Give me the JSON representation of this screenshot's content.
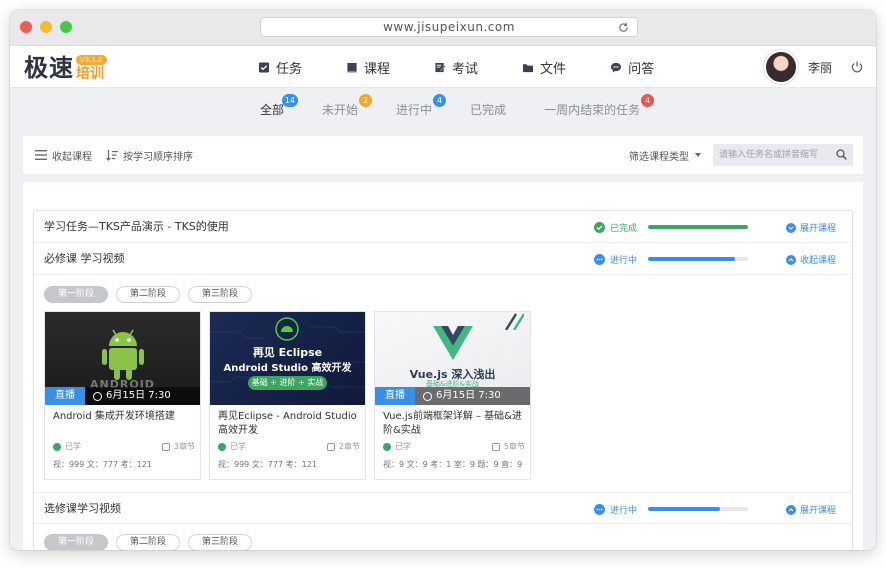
{
  "browser": {
    "url": "www.jisupeixun.com"
  },
  "brand": {
    "name": "极速",
    "version": "V3.1.0",
    "sub": "培训"
  },
  "nav": {
    "items": [
      {
        "label": "任务",
        "icon": "task-checkbox-icon"
      },
      {
        "label": "课程",
        "icon": "course-book-icon"
      },
      {
        "label": "考试",
        "icon": "exam-pencil-icon"
      },
      {
        "label": "文件",
        "icon": "folder-icon"
      },
      {
        "label": "问答",
        "icon": "chat-bubble-icon"
      }
    ]
  },
  "user": {
    "name": "李丽"
  },
  "filters": [
    {
      "label": "全部",
      "count": "14",
      "color": "#3a8ee6"
    },
    {
      "label": "未开始",
      "count": "2",
      "color": "#f5a623"
    },
    {
      "label": "进行中",
      "count": "4",
      "color": "#3a8ee6"
    },
    {
      "label": "已完成",
      "count": "",
      "color": ""
    },
    {
      "label": "一周内结束的任务",
      "count": "4",
      "color": "#ef5350"
    }
  ],
  "toolbar": {
    "collapse": "收起课程",
    "sort": "按学习顺序排序",
    "type_filter": "筛选课程类型",
    "search_placeholder": "请输入任务名或拼音缩写"
  },
  "task": {
    "title": "学习任务—TKS产品演示 - TKS的使用",
    "status": "已完成",
    "progress": 1.0,
    "action": "展开课程"
  },
  "required": {
    "title": "必修课 学习视频",
    "status": "进行中",
    "progress": 0.87,
    "action": "收起课程",
    "stages": [
      "第一阶段",
      "第二阶段",
      "第三阶段"
    ]
  },
  "courses": [
    {
      "live": "直播",
      "time": "6月15日 7:30",
      "title": "Android 集成开发环境搭建",
      "learned": "已学",
      "chapters": "3章节",
      "stats": "视：999  文：777  考：121",
      "thumb_text": "ANDROID"
    },
    {
      "live": "",
      "time": "",
      "title": "再见Eclipse - Android Studio 高效开发",
      "learned": "已学",
      "chapters": "2章节",
      "stats": "视：999  文：777  考：121",
      "thumb_title1": "再见 Eclipse",
      "thumb_title2": "Android Studio 高效开发",
      "thumb_tag": "基础 + 进阶 + 实战"
    },
    {
      "live": "直播",
      "time": "6月15日 7:30",
      "title": "Vue.js前端框架详解 – 基础&进阶&实战",
      "learned": "已学",
      "chapters": "5章节",
      "stats": "视：9   文：9   考：1   室：9   题：9   直：9",
      "thumb_title": "Vue.js 深入浅出",
      "thumb_tag": "基础&进阶&实战"
    }
  ],
  "elective": {
    "title": "选修课学习视频",
    "status": "进行中",
    "progress": 0.72,
    "action": "展开课程",
    "stages": [
      "第一阶段",
      "第二阶段",
      "第三阶段"
    ]
  },
  "colors": {
    "accent": "#3a8ee6",
    "success": "#3ea462",
    "brand_orange": "#f29b26"
  }
}
